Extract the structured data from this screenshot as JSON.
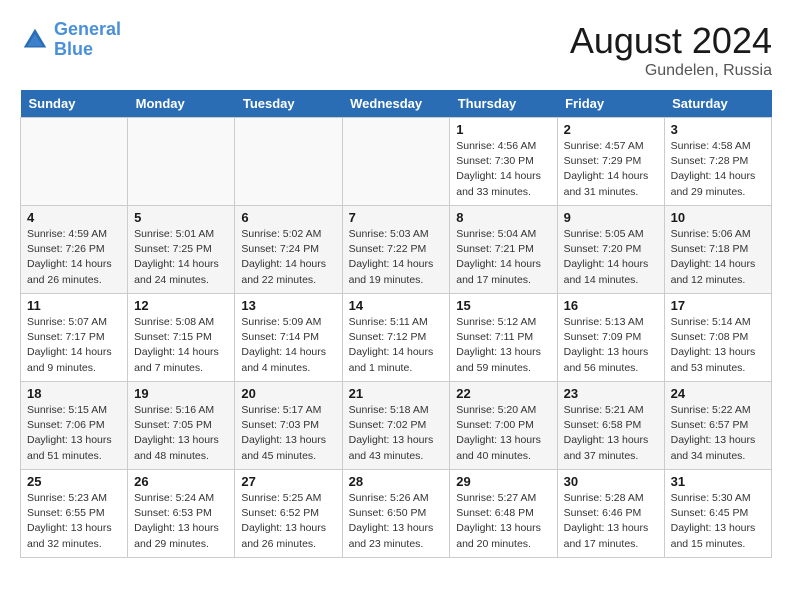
{
  "header": {
    "logo_line1": "General",
    "logo_line2": "Blue",
    "month_year": "August 2024",
    "location": "Gundelen, Russia"
  },
  "days_of_week": [
    "Sunday",
    "Monday",
    "Tuesday",
    "Wednesday",
    "Thursday",
    "Friday",
    "Saturday"
  ],
  "weeks": [
    [
      {
        "day": "",
        "info": ""
      },
      {
        "day": "",
        "info": ""
      },
      {
        "day": "",
        "info": ""
      },
      {
        "day": "",
        "info": ""
      },
      {
        "day": "1",
        "info": "Sunrise: 4:56 AM\nSunset: 7:30 PM\nDaylight: 14 hours\nand 33 minutes."
      },
      {
        "day": "2",
        "info": "Sunrise: 4:57 AM\nSunset: 7:29 PM\nDaylight: 14 hours\nand 31 minutes."
      },
      {
        "day": "3",
        "info": "Sunrise: 4:58 AM\nSunset: 7:28 PM\nDaylight: 14 hours\nand 29 minutes."
      }
    ],
    [
      {
        "day": "4",
        "info": "Sunrise: 4:59 AM\nSunset: 7:26 PM\nDaylight: 14 hours\nand 26 minutes."
      },
      {
        "day": "5",
        "info": "Sunrise: 5:01 AM\nSunset: 7:25 PM\nDaylight: 14 hours\nand 24 minutes."
      },
      {
        "day": "6",
        "info": "Sunrise: 5:02 AM\nSunset: 7:24 PM\nDaylight: 14 hours\nand 22 minutes."
      },
      {
        "day": "7",
        "info": "Sunrise: 5:03 AM\nSunset: 7:22 PM\nDaylight: 14 hours\nand 19 minutes."
      },
      {
        "day": "8",
        "info": "Sunrise: 5:04 AM\nSunset: 7:21 PM\nDaylight: 14 hours\nand 17 minutes."
      },
      {
        "day": "9",
        "info": "Sunrise: 5:05 AM\nSunset: 7:20 PM\nDaylight: 14 hours\nand 14 minutes."
      },
      {
        "day": "10",
        "info": "Sunrise: 5:06 AM\nSunset: 7:18 PM\nDaylight: 14 hours\nand 12 minutes."
      }
    ],
    [
      {
        "day": "11",
        "info": "Sunrise: 5:07 AM\nSunset: 7:17 PM\nDaylight: 14 hours\nand 9 minutes."
      },
      {
        "day": "12",
        "info": "Sunrise: 5:08 AM\nSunset: 7:15 PM\nDaylight: 14 hours\nand 7 minutes."
      },
      {
        "day": "13",
        "info": "Sunrise: 5:09 AM\nSunset: 7:14 PM\nDaylight: 14 hours\nand 4 minutes."
      },
      {
        "day": "14",
        "info": "Sunrise: 5:11 AM\nSunset: 7:12 PM\nDaylight: 14 hours\nand 1 minute."
      },
      {
        "day": "15",
        "info": "Sunrise: 5:12 AM\nSunset: 7:11 PM\nDaylight: 13 hours\nand 59 minutes."
      },
      {
        "day": "16",
        "info": "Sunrise: 5:13 AM\nSunset: 7:09 PM\nDaylight: 13 hours\nand 56 minutes."
      },
      {
        "day": "17",
        "info": "Sunrise: 5:14 AM\nSunset: 7:08 PM\nDaylight: 13 hours\nand 53 minutes."
      }
    ],
    [
      {
        "day": "18",
        "info": "Sunrise: 5:15 AM\nSunset: 7:06 PM\nDaylight: 13 hours\nand 51 minutes."
      },
      {
        "day": "19",
        "info": "Sunrise: 5:16 AM\nSunset: 7:05 PM\nDaylight: 13 hours\nand 48 minutes."
      },
      {
        "day": "20",
        "info": "Sunrise: 5:17 AM\nSunset: 7:03 PM\nDaylight: 13 hours\nand 45 minutes."
      },
      {
        "day": "21",
        "info": "Sunrise: 5:18 AM\nSunset: 7:02 PM\nDaylight: 13 hours\nand 43 minutes."
      },
      {
        "day": "22",
        "info": "Sunrise: 5:20 AM\nSunset: 7:00 PM\nDaylight: 13 hours\nand 40 minutes."
      },
      {
        "day": "23",
        "info": "Sunrise: 5:21 AM\nSunset: 6:58 PM\nDaylight: 13 hours\nand 37 minutes."
      },
      {
        "day": "24",
        "info": "Sunrise: 5:22 AM\nSunset: 6:57 PM\nDaylight: 13 hours\nand 34 minutes."
      }
    ],
    [
      {
        "day": "25",
        "info": "Sunrise: 5:23 AM\nSunset: 6:55 PM\nDaylight: 13 hours\nand 32 minutes."
      },
      {
        "day": "26",
        "info": "Sunrise: 5:24 AM\nSunset: 6:53 PM\nDaylight: 13 hours\nand 29 minutes."
      },
      {
        "day": "27",
        "info": "Sunrise: 5:25 AM\nSunset: 6:52 PM\nDaylight: 13 hours\nand 26 minutes."
      },
      {
        "day": "28",
        "info": "Sunrise: 5:26 AM\nSunset: 6:50 PM\nDaylight: 13 hours\nand 23 minutes."
      },
      {
        "day": "29",
        "info": "Sunrise: 5:27 AM\nSunset: 6:48 PM\nDaylight: 13 hours\nand 20 minutes."
      },
      {
        "day": "30",
        "info": "Sunrise: 5:28 AM\nSunset: 6:46 PM\nDaylight: 13 hours\nand 17 minutes."
      },
      {
        "day": "31",
        "info": "Sunrise: 5:30 AM\nSunset: 6:45 PM\nDaylight: 13 hours\nand 15 minutes."
      }
    ]
  ]
}
